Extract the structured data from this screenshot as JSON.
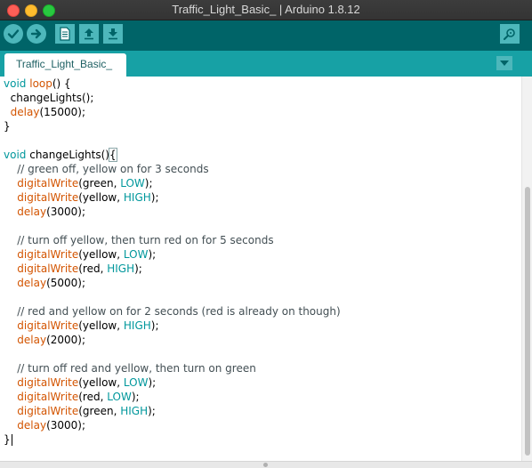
{
  "window": {
    "title": "Traffic_Light_Basic_ | Arduino 1.8.12"
  },
  "toolbar": {
    "buttons": [
      {
        "name": "verify",
        "icon": "checkmark-icon"
      },
      {
        "name": "upload",
        "icon": "arrow-right-icon"
      },
      {
        "name": "new",
        "icon": "new-file-icon"
      },
      {
        "name": "open",
        "icon": "arrow-up-icon"
      },
      {
        "name": "save",
        "icon": "arrow-down-icon"
      },
      {
        "name": "serial-monitor",
        "icon": "magnifier-icon"
      }
    ]
  },
  "tabs": [
    {
      "label": "Traffic_Light_Basic_",
      "active": true
    }
  ],
  "colors": {
    "toolbar_bg": "#006468",
    "tabbar_bg": "#17a1a5",
    "button_bg": "#4db7bb",
    "keyword": "#00979c",
    "function": "#d35400",
    "constant": "#00979c",
    "comment": "#434f54"
  },
  "editor": {
    "lines": [
      [
        {
          "t": "void",
          "c": "keyword"
        },
        {
          "t": " "
        },
        {
          "t": "loop",
          "c": "function"
        },
        {
          "t": "() {"
        }
      ],
      [
        {
          "t": "  changeLights();"
        }
      ],
      [
        {
          "t": "  "
        },
        {
          "t": "delay",
          "c": "function"
        },
        {
          "t": "(15000);"
        }
      ],
      [
        {
          "t": "}"
        }
      ],
      [
        {
          "t": ""
        }
      ],
      [
        {
          "t": "void",
          "c": "keyword"
        },
        {
          "t": " changeLights()"
        },
        {
          "t": "{",
          "c": "match"
        }
      ],
      [
        {
          "t": "    // green off, yellow on for 3 seconds",
          "c": "comment"
        }
      ],
      [
        {
          "t": "    "
        },
        {
          "t": "digitalWrite",
          "c": "function"
        },
        {
          "t": "(green, "
        },
        {
          "t": "LOW",
          "c": "constant"
        },
        {
          "t": ");"
        }
      ],
      [
        {
          "t": "    "
        },
        {
          "t": "digitalWrite",
          "c": "function"
        },
        {
          "t": "(yellow, "
        },
        {
          "t": "HIGH",
          "c": "constant"
        },
        {
          "t": ");"
        }
      ],
      [
        {
          "t": "    "
        },
        {
          "t": "delay",
          "c": "function"
        },
        {
          "t": "(3000);"
        }
      ],
      [
        {
          "t": ""
        }
      ],
      [
        {
          "t": "    // turn off yellow, then turn red on for 5 seconds",
          "c": "comment"
        }
      ],
      [
        {
          "t": "    "
        },
        {
          "t": "digitalWrite",
          "c": "function"
        },
        {
          "t": "(yellow, "
        },
        {
          "t": "LOW",
          "c": "constant"
        },
        {
          "t": ");"
        }
      ],
      [
        {
          "t": "    "
        },
        {
          "t": "digitalWrite",
          "c": "function"
        },
        {
          "t": "(red, "
        },
        {
          "t": "HIGH",
          "c": "constant"
        },
        {
          "t": ");"
        }
      ],
      [
        {
          "t": "    "
        },
        {
          "t": "delay",
          "c": "function"
        },
        {
          "t": "(5000);"
        }
      ],
      [
        {
          "t": ""
        }
      ],
      [
        {
          "t": "    // red and yellow on for 2 seconds (red is already on though)",
          "c": "comment"
        }
      ],
      [
        {
          "t": "    "
        },
        {
          "t": "digitalWrite",
          "c": "function"
        },
        {
          "t": "(yellow, "
        },
        {
          "t": "HIGH",
          "c": "constant"
        },
        {
          "t": ");"
        }
      ],
      [
        {
          "t": "    "
        },
        {
          "t": "delay",
          "c": "function"
        },
        {
          "t": "(2000);"
        }
      ],
      [
        {
          "t": ""
        }
      ],
      [
        {
          "t": "    // turn off red and yellow, then turn on green",
          "c": "comment"
        }
      ],
      [
        {
          "t": "    "
        },
        {
          "t": "digitalWrite",
          "c": "function"
        },
        {
          "t": "(yellow, "
        },
        {
          "t": "LOW",
          "c": "constant"
        },
        {
          "t": ");"
        }
      ],
      [
        {
          "t": "    "
        },
        {
          "t": "digitalWrite",
          "c": "function"
        },
        {
          "t": "(red, "
        },
        {
          "t": "LOW",
          "c": "constant"
        },
        {
          "t": ");"
        }
      ],
      [
        {
          "t": "    "
        },
        {
          "t": "digitalWrite",
          "c": "function"
        },
        {
          "t": "(green, "
        },
        {
          "t": "HIGH",
          "c": "constant"
        },
        {
          "t": ");"
        }
      ],
      [
        {
          "t": "    "
        },
        {
          "t": "delay",
          "c": "function"
        },
        {
          "t": "(3000);"
        }
      ],
      [
        {
          "t": "}"
        },
        {
          "t": "",
          "c": "caret"
        }
      ]
    ]
  }
}
